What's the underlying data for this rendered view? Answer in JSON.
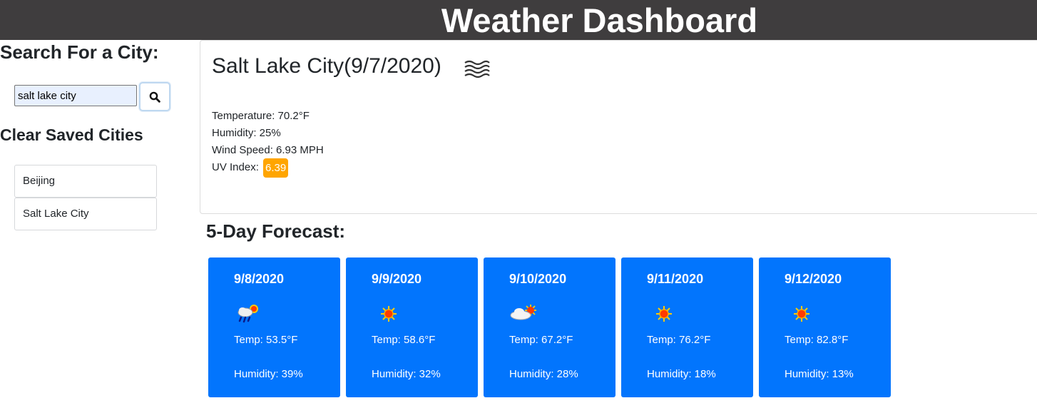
{
  "header": {
    "title": "Weather Dashboard"
  },
  "sidebar": {
    "search_heading": "Search For a City:",
    "search_input_value": "salt lake city",
    "search_button_icon": "search-icon",
    "clear_label": "Clear Saved Cities",
    "saved_cities": [
      "Beijing",
      "Salt Lake City"
    ]
  },
  "current": {
    "city_title": "Salt Lake City(9/7/2020)",
    "icon": "mist-icon",
    "temperature": "Temperature: 70.2°F",
    "humidity": "Humidity: 25%",
    "wind": "Wind Speed: 6.93 MPH",
    "uv_label": "UV Index:",
    "uv_value": "6.39",
    "uv_color": "#ffa500"
  },
  "forecast": {
    "heading": "5-Day Forecast:",
    "card_color": "#0275fd",
    "days": [
      {
        "date": "9/8/2020",
        "icon": "rain-sun-icon",
        "temp": "Temp: 53.5°F",
        "humidity": "Humidity: 39%"
      },
      {
        "date": "9/9/2020",
        "icon": "sun-icon",
        "temp": "Temp: 58.6°F",
        "humidity": "Humidity: 32%"
      },
      {
        "date": "9/10/2020",
        "icon": "cloud-sun-icon",
        "temp": "Temp: 67.2°F",
        "humidity": "Humidity: 28%"
      },
      {
        "date": "9/11/2020",
        "icon": "sun-icon",
        "temp": "Temp: 76.2°F",
        "humidity": "Humidity: 18%"
      },
      {
        "date": "9/12/2020",
        "icon": "sun-icon",
        "temp": "Temp: 82.8°F",
        "humidity": "Humidity: 13%"
      }
    ]
  }
}
